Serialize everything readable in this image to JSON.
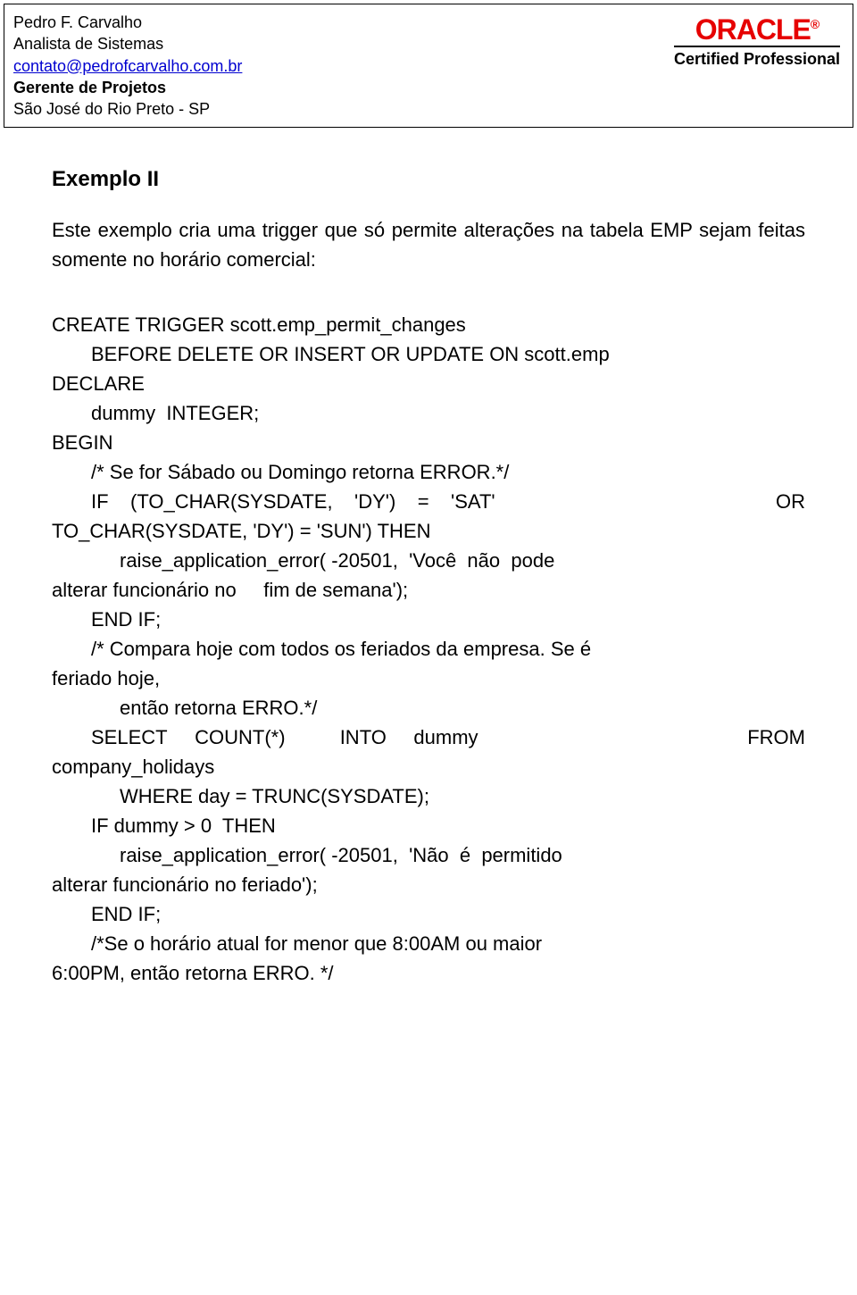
{
  "header": {
    "name": "Pedro F. Carvalho",
    "role1": "Analista de Sistemas",
    "email": "contato@pedrofcarvalho.com.br",
    "role2": "Gerente de Projetos",
    "location": "São José do Rio Preto - SP",
    "oracle_brand": "ORACLE",
    "oracle_reg": "®",
    "oracle_cert": "Certified Professional"
  },
  "content": {
    "heading": "Exemplo II",
    "intro": "Este exemplo cria uma trigger que só permite alterações na tabela EMP sejam feitas somente no horário comercial:",
    "code": {
      "l01": "CREATE TRIGGER scott.emp_permit_changes",
      "l02": "BEFORE DELETE OR INSERT OR UPDATE ON scott.emp",
      "l03": "DECLARE",
      "l04": "dummy  INTEGER;",
      "l05": "BEGIN",
      "l06": "/* Se for Sábado ou Domingo retorna ERROR.*/",
      "l07a": "IF (TO_CHAR(SYSDATE, 'DY') = 'SAT' OR",
      "l07b": "TO_CHAR(SYSDATE, 'DY') = 'SUN') THEN",
      "l08a": "raise_application_error( -20501, 'Você não pode",
      "l08b": "alterar funcionário no     fim de semana');",
      "l09": "END IF;",
      "l10a": "/* Compara hoje com todos os feriados da empresa. Se é",
      "l10b": "feriado hoje,",
      "l11": "então retorna ERRO.*/",
      "l12a": "SELECT COUNT(*) INTO dummy FROM",
      "l12b": "company_holidays",
      "l13": "WHERE day = TRUNC(SYSDATE);",
      "l14": "IF dummy > 0  THEN",
      "l15a": "raise_application_error( -20501, 'Não é permitido",
      "l15b": "alterar funcionário no feriado');",
      "l16": "END IF;",
      "l17a": "/*Se o horário atual for menor que 8:00AM ou maior",
      "l17b": "6:00PM, então retorna ERRO. */"
    }
  }
}
